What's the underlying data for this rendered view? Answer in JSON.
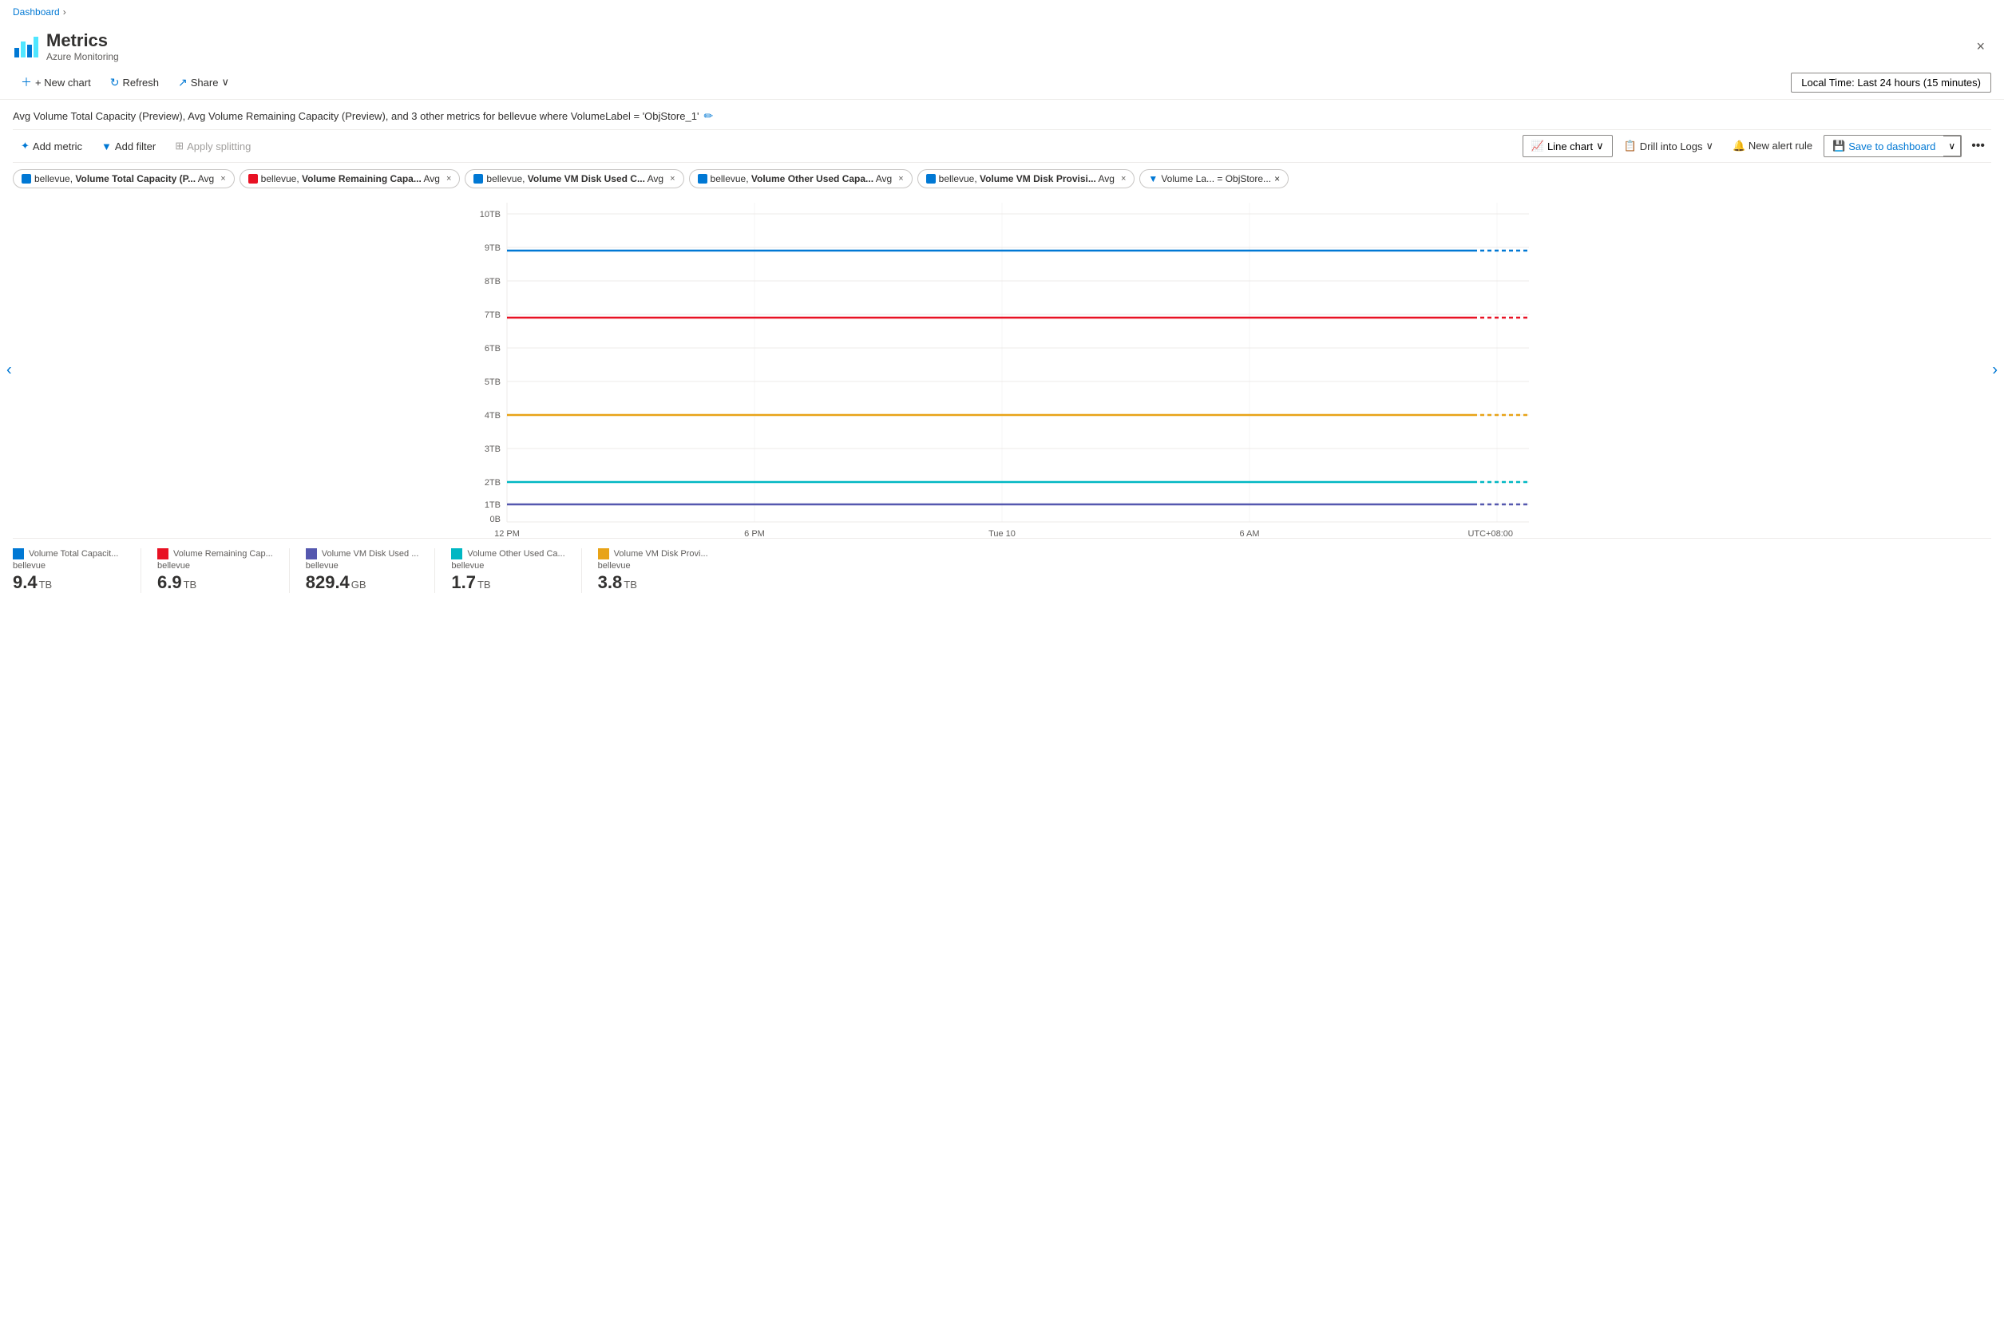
{
  "breadcrumb": {
    "label": "Dashboard",
    "chevron": "›"
  },
  "header": {
    "title": "Metrics",
    "subtitle": "Azure Monitoring",
    "close_label": "×"
  },
  "toolbar": {
    "new_chart": "+ New chart",
    "refresh": "Refresh",
    "share": "Share",
    "share_chevron": "∨",
    "time_picker": "Local Time: Last 24 hours (15 minutes)"
  },
  "chart_title": "Avg Volume Total Capacity (Preview), Avg Volume Remaining Capacity (Preview), and 3 other metrics for bellevue where VolumeLabel = 'ObjStore_1'",
  "metrics_toolbar": {
    "add_metric": "Add metric",
    "add_filter": "Add filter",
    "apply_splitting": "Apply splitting",
    "line_chart": "Line chart",
    "drill_logs": "Drill into Logs",
    "new_alert": "New alert rule",
    "save_dashboard": "Save to dashboard"
  },
  "metric_tags": [
    {
      "id": "tag1",
      "color": "#0078d4",
      "text": "bellevue, Volume Total Capacity (P... Avg"
    },
    {
      "id": "tag2",
      "color": "#e81123",
      "text": "bellevue, Volume Remaining Capa... Avg"
    },
    {
      "id": "tag3",
      "color": "#0078d4",
      "text": "bellevue, Volume VM Disk Used C... Avg"
    },
    {
      "id": "tag4",
      "color": "#0078d4",
      "text": "bellevue, Volume Other Used Capa... Avg"
    },
    {
      "id": "tag5",
      "color": "#0078d4",
      "text": "bellevue, Volume VM Disk Provisi... Avg"
    }
  ],
  "filter_tag": "Volume La...  =  ObjStore...",
  "y_axis_labels": [
    "10TB",
    "9TB",
    "8TB",
    "7TB",
    "6TB",
    "5TB",
    "4TB",
    "3TB",
    "2TB",
    "1TB",
    "0B"
  ],
  "x_axis_labels": [
    "12 PM",
    "6 PM",
    "Tue 10",
    "6 AM",
    "UTC+08:00"
  ],
  "chart_lines": [
    {
      "id": "line1",
      "color": "#0078d4",
      "y_percent": 10,
      "label": "blue solid"
    },
    {
      "id": "line2",
      "color": "#e81123",
      "y_percent": 28,
      "label": "red solid"
    },
    {
      "id": "line3",
      "color": "#e8a317",
      "y_percent": 61,
      "label": "orange solid"
    },
    {
      "id": "line4",
      "color": "#00b7c3",
      "y_percent": 83,
      "label": "cyan solid"
    },
    {
      "id": "line5",
      "color": "#5558af",
      "y_percent": 90,
      "label": "purple solid"
    }
  ],
  "legend": [
    {
      "id": "leg1",
      "color": "#0078d4",
      "title": "Volume Total Capacit...",
      "subtitle": "bellevue",
      "value": "9.4",
      "unit": "TB"
    },
    {
      "id": "leg2",
      "color": "#e81123",
      "title": "Volume Remaining Cap...",
      "subtitle": "bellevue",
      "value": "6.9",
      "unit": "TB"
    },
    {
      "id": "leg3",
      "color": "#107c10",
      "title": "Volume VM Disk Used ...",
      "subtitle": "bellevue",
      "value": "829.4",
      "unit": "GB"
    },
    {
      "id": "leg4",
      "color": "#00b7c3",
      "title": "Volume Other Used Ca...",
      "subtitle": "bellevue",
      "value": "1.7",
      "unit": "TB"
    },
    {
      "id": "leg5",
      "color": "#e8a317",
      "title": "Volume VM Disk Provi...",
      "subtitle": "bellevue",
      "value": "3.8",
      "unit": "TB"
    }
  ]
}
